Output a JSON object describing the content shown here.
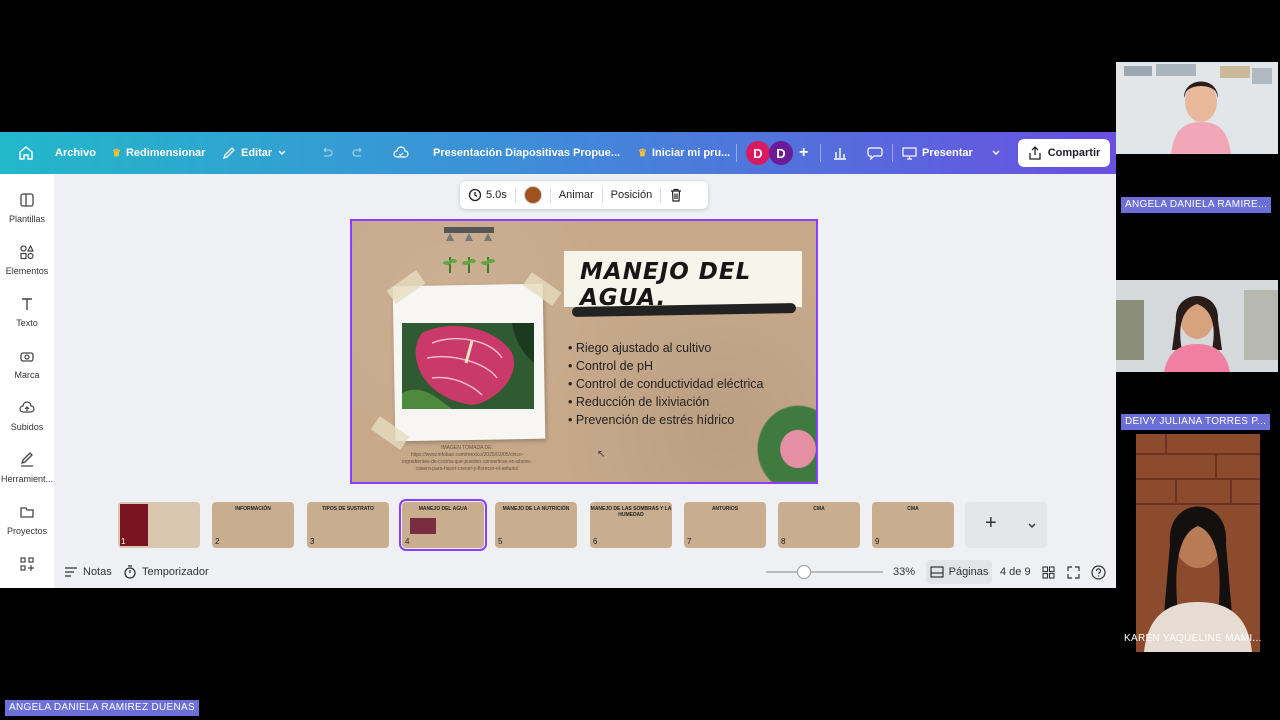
{
  "app": {
    "toolbar": {
      "file": "Archivo",
      "resize": "Redimensionar",
      "edit": "Editar",
      "doc_title": "Presentación Diapositivas Propue...",
      "trial": "Iniciar mi pru...",
      "avatars": [
        "D",
        "D"
      ],
      "present": "Presentar",
      "share": "Compartir"
    },
    "sidebar": {
      "items": [
        {
          "label": "Plantillas",
          "icon": "templates-icon"
        },
        {
          "label": "Elementos",
          "icon": "elements-icon"
        },
        {
          "label": "Texto",
          "icon": "text-icon"
        },
        {
          "label": "Marca",
          "icon": "brand-icon"
        },
        {
          "label": "Subidos",
          "icon": "uploads-icon"
        },
        {
          "label": "Herramient...",
          "icon": "draw-icon"
        },
        {
          "label": "Proyectos",
          "icon": "folder-icon"
        }
      ]
    },
    "float_toolbar": {
      "duration": "5.0s",
      "color": "#a0521c",
      "animate": "Animar",
      "position": "Posición"
    },
    "slide": {
      "title": "MANEJO DEL AGUA.",
      "bullets": [
        "Riego ajustado al cultivo",
        "Control de pH",
        "Control de conductividad eléctrica",
        "Reducción de lixiviación",
        "Prevención de estrés hídrico"
      ],
      "credit": "IMAGEN TOMADA DE: https://www.infobae.com/mexico/2025/03/05/cinco-ingredientes-de-cocina-que-pueden-convertirse-en-abono-casero-para-hacer-crecer-y-florecer-el-anturio/"
    },
    "thumbnails": [
      {
        "num": "1",
        "label": ""
      },
      {
        "num": "2",
        "label": "INFORMACIÓN"
      },
      {
        "num": "3",
        "label": "TIPOS DE SUSTRATO"
      },
      {
        "num": "4",
        "label": "MANEJO DEL AGUA"
      },
      {
        "num": "5",
        "label": "MANEJO DE LA NUTRICIÓN"
      },
      {
        "num": "6",
        "label": "MANEJO DE LAS SOMBRAS Y LA HUMEDAD"
      },
      {
        "num": "7",
        "label": "ANTURIOS"
      },
      {
        "num": "8",
        "label": "CMA"
      },
      {
        "num": "9",
        "label": "CMA"
      }
    ],
    "bottom": {
      "notes": "Notas",
      "timer": "Temporizador",
      "zoom": "33%",
      "zoom_level": 0.33,
      "pages": "Páginas",
      "page_count": "4 de 9"
    }
  },
  "participants": [
    {
      "name": "ANGELA DANIELA RAMIRE..."
    },
    {
      "name": "DEIVY JULIANA TORRES P..."
    },
    {
      "name": "KAREN YAQUELINE MAMI..."
    }
  ],
  "self_name": "ANGELA DANIELA RAMIREZ DUENAS",
  "colors": {
    "accent": "#8b3dff",
    "name_tag": "#6b6fd6",
    "avatar1": "#d81b60",
    "avatar2": "#6a1b9a"
  }
}
